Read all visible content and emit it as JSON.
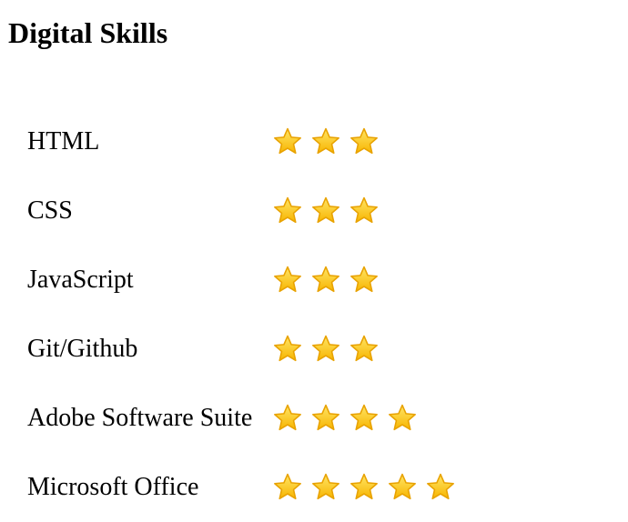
{
  "heading": "Digital Skills",
  "colors": {
    "star_fill_top": "#ffe566",
    "star_fill_bottom": "#f7b500",
    "star_stroke": "#e8a200"
  },
  "skills": [
    {
      "name": "HTML",
      "rating": 3,
      "rating_max": 5,
      "icon": "star-icon"
    },
    {
      "name": "CSS",
      "rating": 3,
      "rating_max": 5,
      "icon": "star-icon"
    },
    {
      "name": "JavaScript",
      "rating": 3,
      "rating_max": 5,
      "icon": "star-icon"
    },
    {
      "name": "Git/Github",
      "rating": 3,
      "rating_max": 5,
      "icon": "star-icon"
    },
    {
      "name": "Adobe Software Suite",
      "rating": 4,
      "rating_max": 5,
      "icon": "star-icon"
    },
    {
      "name": "Microsoft Office",
      "rating": 5,
      "rating_max": 5,
      "icon": "star-icon"
    }
  ]
}
